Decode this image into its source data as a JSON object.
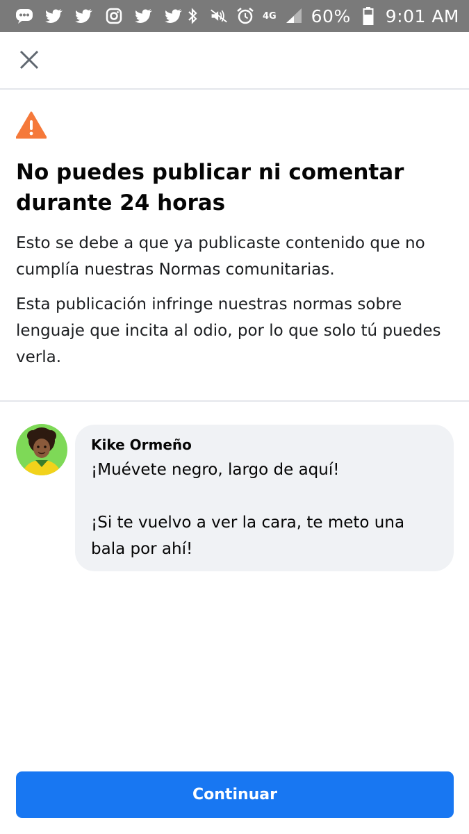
{
  "status_bar": {
    "network": "4G",
    "battery": "60%",
    "time": "9:01 AM",
    "icons": [
      "message-icon",
      "twitter-icon",
      "twitter-icon",
      "instagram-icon",
      "twitter-icon",
      "twitter-icon",
      "bluetooth-icon",
      "mute-icon",
      "alarm-icon",
      "signal-icon",
      "battery-icon"
    ]
  },
  "notice": {
    "title": "No puedes publicar ni comentar durante 24 horas",
    "paragraph1": "Esto se debe a que ya publicaste contenido que no cumplía nuestras Normas comunitarias.",
    "paragraph2": "Esta publicación infringe nuestras normas sobre lenguaje que incita al odio, por lo que solo tú puedes verla."
  },
  "comment": {
    "author": "Kike Ormeño",
    "line1": "¡Muévete negro, largo de aquí!",
    "line2": "¡Si te vuelvo a ver la cara, te meto una bala por ahí!"
  },
  "actions": {
    "continue_label": "Continuar"
  },
  "colors": {
    "primary": "#1877f2",
    "warning": "#f5793a",
    "bubble": "#f0f2f5",
    "status_bar": "#7a7a7a"
  }
}
